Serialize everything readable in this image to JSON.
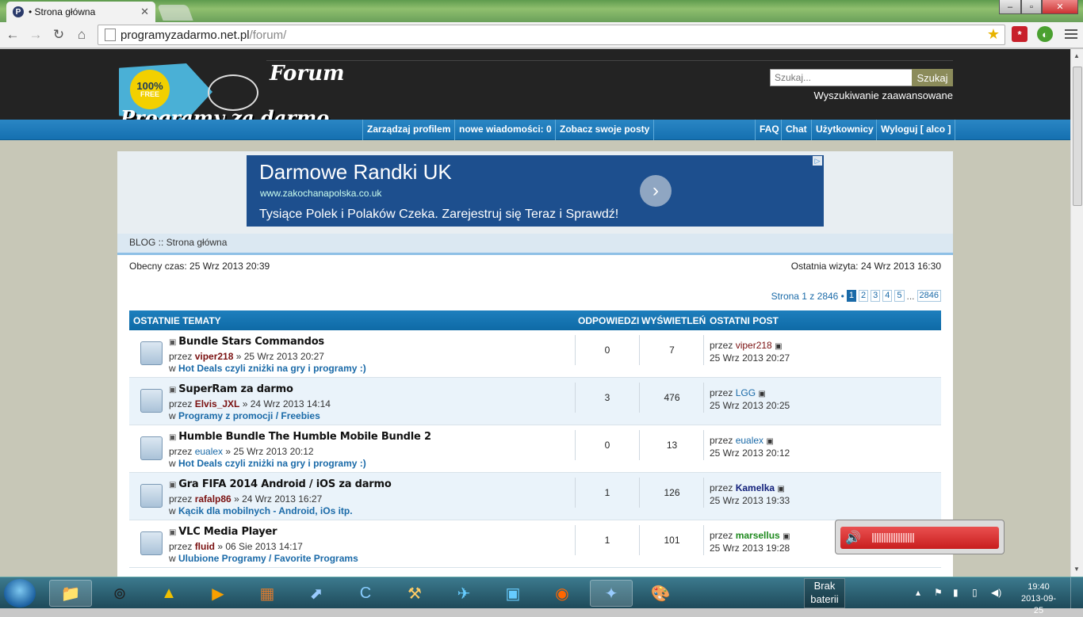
{
  "browser": {
    "tab_title": "• Strona główna",
    "tab_favicon_letter": "P",
    "url_host": "programyzadarmo.net.pl",
    "url_path": "/forum/",
    "window_buttons": {
      "minimize": "–",
      "maximize": "▫",
      "close": "✕"
    }
  },
  "header": {
    "logo_forum": "Forum",
    "logo_badge": "100%",
    "logo_badge_sub": "FREE",
    "logo_text": "Programy za darmo",
    "search_placeholder": "Szukaj...",
    "search_button": "Szukaj",
    "advanced_search": "Wyszukiwanie zaawansowane"
  },
  "nav": {
    "left": [
      "Zarządzaj profilem",
      "nowe wiadomości: 0",
      "Zobacz swoje posty"
    ],
    "right": [
      "FAQ",
      "Chat",
      "Użytkownicy",
      "Wyloguj [ alco ]"
    ]
  },
  "ad": {
    "title": "Darmowe Randki UK",
    "url": "www.zakochanapolska.co.uk",
    "description": "Tysiące Polek i Polaków Czeka. Zarejestruj się Teraz i Sprawdź!"
  },
  "breadcrumb": "BLOG :: Strona główna",
  "current_time": "Obecny czas: 25 Wrz 2013 20:39",
  "last_visit": "Ostatnia wizyta: 24 Wrz 2013 16:30",
  "pagination": {
    "label": "Strona 1 z 2846 •",
    "pages": [
      "1",
      "2",
      "3",
      "4",
      "5"
    ],
    "ellipsis": "...",
    "last": "2846"
  },
  "topics": {
    "headers": {
      "topics": "OSTATNIE TEMATY",
      "replies": "ODPOWIEDZI",
      "views": "WYŚWIETLEŃ",
      "last_post": "OSTATNI POST"
    },
    "rows": [
      {
        "title": "Bundle Stars Commandos",
        "by": "przez",
        "author": "viper218",
        "date": "» 25 Wrz 2013 20:27",
        "in": "w",
        "forum": "Hot Deals czyli zniżki na gry i programy :)",
        "replies": "0",
        "views": "7",
        "lp_by": "przez",
        "lp_user": "viper218",
        "lp_date": "25 Wrz 2013 20:27"
      },
      {
        "title": "SuperRam za darmo",
        "by": "przez",
        "author": "Elvis_JXL",
        "date": "» 24 Wrz 2013 14:14",
        "in": "w",
        "forum": "Programy z promocji / Freebies",
        "replies": "3",
        "views": "476",
        "lp_by": "przez",
        "lp_user": "LGG",
        "lp_date": "25 Wrz 2013 20:25"
      },
      {
        "title": "Humble Bundle The Humble Mobile Bundle 2",
        "by": "przez",
        "author": "eualex",
        "date": "» 25 Wrz 2013 20:12",
        "in": "w",
        "forum": "Hot Deals czyli zniżki na gry i programy :)",
        "replies": "0",
        "views": "13",
        "lp_by": "przez",
        "lp_user": "eualex",
        "lp_date": "25 Wrz 2013 20:12"
      },
      {
        "title": "Gra FIFA 2014 Android / iOS za darmo",
        "by": "przez",
        "author": "rafalp86",
        "date": "» 24 Wrz 2013 16:27",
        "in": "w",
        "forum": "Kącik dla mobilnych - Android, iOs itp.",
        "replies": "1",
        "views": "126",
        "lp_by": "przez",
        "lp_user": "Kamelka",
        "lp_date": "25 Wrz 2013 19:33"
      },
      {
        "title": "VLC Media Player",
        "by": "przez",
        "author": "fluid",
        "date": "» 06 Sie 2013 14:17",
        "in": "w",
        "forum": "Ulubione Programy / Favorite Programs",
        "replies": "1",
        "views": "101",
        "lp_by": "przez",
        "lp_user": "marsellus",
        "lp_date": "25 Wrz 2013 19:28"
      }
    ]
  },
  "taskbar": {
    "battery_label": "Brak baterii",
    "time": "19:40",
    "date": "2013-09-25"
  },
  "colors": {
    "accent": "#1a6aa8",
    "header_bg": "#232323",
    "volume": "#d83030"
  },
  "volume_level": 0.3
}
